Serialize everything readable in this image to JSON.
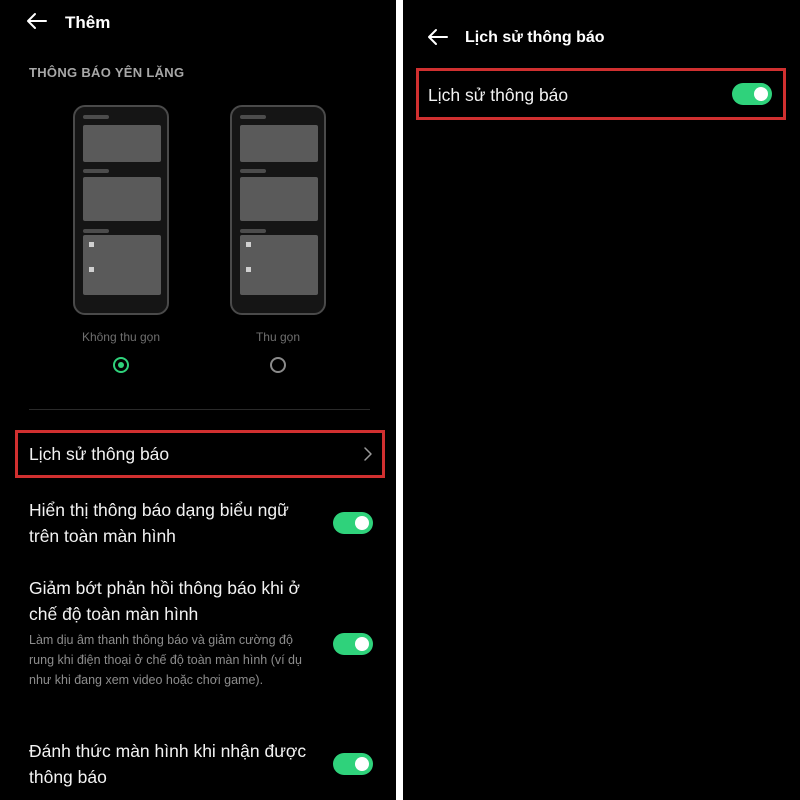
{
  "left_screen": {
    "header": {
      "title": "Thêm"
    },
    "section_title": "THÔNG BÁO YÊN LẶNG",
    "options": [
      {
        "label": "Không thu gọn",
        "selected": true
      },
      {
        "label": "Thu gọn",
        "selected": false
      }
    ],
    "history_row": {
      "label": "Lịch sử thông báo"
    },
    "settings": [
      {
        "title": "Hiển thị thông báo dạng biểu ngữ trên toàn màn hình",
        "enabled": true
      },
      {
        "title": "Giảm bớt phản hồi thông báo khi ở chế độ toàn màn hình",
        "description": "Làm dịu âm thanh thông báo và giảm cường độ rung khi điện thoại ở chế độ toàn màn hình (ví dụ như khi đang xem video hoặc chơi game).",
        "enabled": true
      },
      {
        "title": "Đánh thức màn hình khi nhận được thông báo",
        "enabled": true
      }
    ]
  },
  "right_screen": {
    "header": {
      "title": "Lịch sử thông báo"
    },
    "history_toggle": {
      "label": "Lịch sử thông báo",
      "enabled": true
    }
  },
  "colors": {
    "background": "#000000",
    "accent_green": "#2fd27b",
    "highlight_red": "#d03030"
  },
  "icons": [
    "back-arrow-icon",
    "chevron-right-icon"
  ]
}
